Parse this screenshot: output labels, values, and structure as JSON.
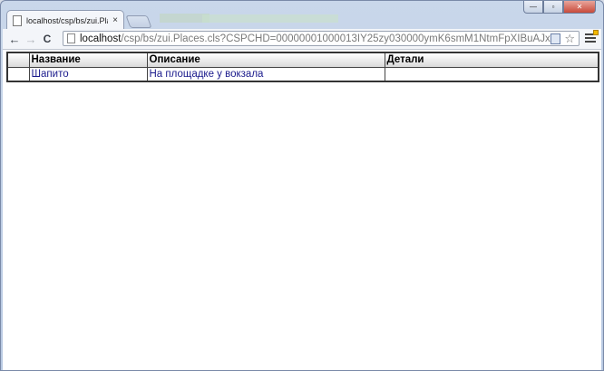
{
  "browser": {
    "tab_title": "localhost/csp/bs/zui.Places",
    "tab_close": "×",
    "back_icon": "←",
    "forward_icon": "→",
    "reload_icon": "C",
    "url_host": "localhost",
    "url_rest": "/csp/bs/zui.Places.cls?CSPCHD=00000001000013IY25zy030000ymK6smM1NtmFpXIBuAJxiw--",
    "star_icon": "☆",
    "min_icon": "—",
    "max_icon": "▫",
    "close_icon": "✕"
  },
  "table": {
    "columns": [
      "",
      "Название",
      "Описание",
      "Детали"
    ],
    "rows": [
      {
        "mark": "",
        "name": "Шапито",
        "description": "На площадке у вокзала",
        "details": ""
      }
    ]
  }
}
